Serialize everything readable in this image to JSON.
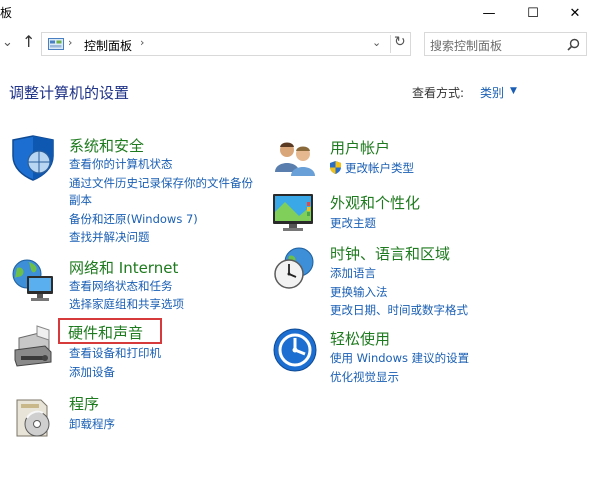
{
  "window": {
    "title": "板",
    "min_glyph": "—",
    "max_glyph": "☐",
    "close_glyph": "✕"
  },
  "address": {
    "path": "控制面板",
    "search_placeholder": "搜索控制面板"
  },
  "page": {
    "title": "调整计算机的设置",
    "view_label": "查看方式:",
    "view_value": "类别"
  },
  "categories": [
    {
      "title": "系统和安全",
      "links": [
        "查看你的计算机状态",
        "通过文件历史记录保存你的文件备份",
        "副本",
        "备份和还原(Windows 7)",
        "查找并解决问题"
      ]
    },
    {
      "title": "网络和 Internet",
      "links": [
        "查看网络状态和任务",
        "选择家庭组和共享选项"
      ]
    },
    {
      "title": "硬件和声音",
      "links": [
        "查看设备和打印机",
        "添加设备"
      ]
    },
    {
      "title": "程序",
      "links": [
        "卸载程序"
      ]
    },
    {
      "title": "用户帐户",
      "links": [
        "更改帐户类型"
      ]
    },
    {
      "title": "外观和个性化",
      "links": [
        "更改主题"
      ]
    },
    {
      "title": "时钟、语言和区域",
      "links": [
        "添加语言",
        "更换输入法",
        "更改日期、时间或数字格式"
      ]
    },
    {
      "title": "轻松使用",
      "links": [
        "使用 Windows 建议的设置",
        "优化视觉显示"
      ]
    }
  ]
}
